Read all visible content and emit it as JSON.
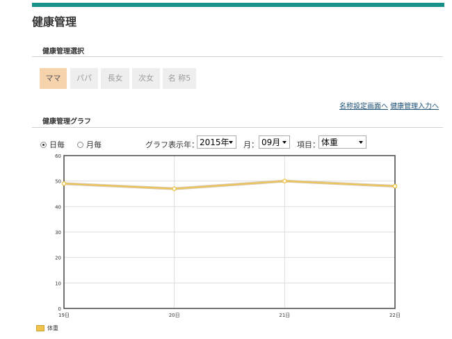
{
  "page": {
    "title": "健康管理",
    "accent_color": "#15918a"
  },
  "selection": {
    "heading": "健康管理選択",
    "tabs": [
      {
        "label": "ママ",
        "active": true
      },
      {
        "label": "パパ",
        "active": false
      },
      {
        "label": "長女",
        "active": false
      },
      {
        "label": "次女",
        "active": false
      },
      {
        "label": "名 称5",
        "active": false
      }
    ]
  },
  "links": {
    "name_settings": "名称設定画面へ",
    "health_input": "健康管理入力へ"
  },
  "graph": {
    "heading": "健康管理グラフ",
    "radio_daily": "日毎",
    "radio_monthly": "月毎",
    "year_label": "グラフ表示年：",
    "year_value": "2015年",
    "month_label": "月：",
    "month_value": "09月",
    "item_label": "項目：",
    "item_value": "体重"
  },
  "chart_data": {
    "type": "line",
    "categories": [
      "19日",
      "20日",
      "21日",
      "22日"
    ],
    "series": [
      {
        "name": "体重",
        "values": [
          49,
          47,
          50,
          48
        ],
        "color": "#f1c34a"
      }
    ],
    "ylim": [
      0,
      60
    ],
    "yticks": [
      0,
      10,
      20,
      30,
      40,
      50,
      60
    ],
    "grid": true,
    "legend": "bottom-left"
  }
}
